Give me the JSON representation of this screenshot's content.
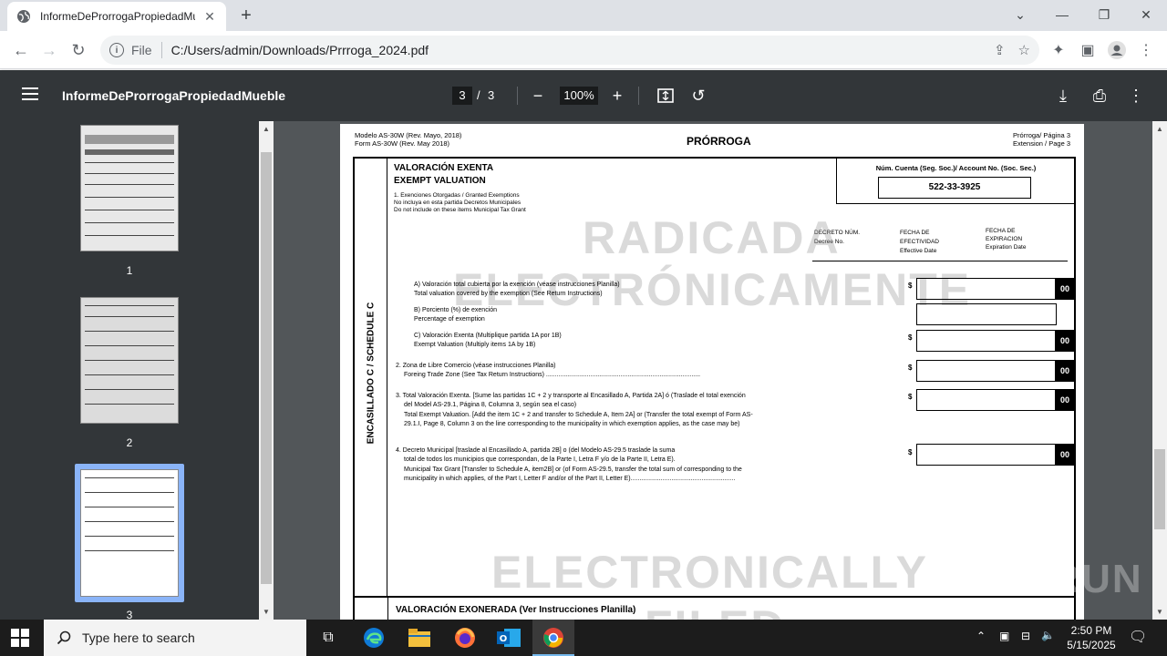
{
  "browser": {
    "tab_title": "InformeDeProrrogaPropiedadMueble",
    "url_scheme": "File",
    "url": "C:/Users/admin/Downloads/Prrroga_2024.pdf"
  },
  "pdf_toolbar": {
    "doc_title": "InformeDeProrrogaPropiedadMueble",
    "current_page": "3",
    "page_sep": "/",
    "total_pages": "3",
    "zoom": "100%"
  },
  "thumbnails": [
    {
      "label": "1"
    },
    {
      "label": "2"
    },
    {
      "label": "3"
    }
  ],
  "page": {
    "model_es": "Modelo AS-30W (Rev. Mayo, 2018)",
    "model_en": "Form AS-30W  (Rev. May 2018)",
    "title": "PRÓRROGA",
    "page_es": "Prórroga/ Página 3",
    "page_en": "Extension / Page 3",
    "account_label": "Núm. Cuenta (Seg. Soc.)/ Account No. (Soc. Sec.)",
    "account_value": "522-33-3925",
    "section_title_es": "VALORACIÓN EXENTA",
    "section_title_en": "EXEMPT VALUATION",
    "section_note_1": "1. Exenciones Otorgadas / Granted Exemptions",
    "section_note_2": "No incluya en esta partida Decretos Municipales",
    "section_note_3": "Do not include on these items Municipal Tax Grant",
    "col_decree_es": "DECRETO NÚM.",
    "col_decree_en": "Decree No.",
    "col_eff_es_1": "FECHA DE",
    "col_eff_es_2": "EFECTIVIDAD",
    "col_eff_en": "Effective Date",
    "col_exp_es_1": "FECHA DE",
    "col_exp_es_2": "EXPIRACION",
    "col_exp_en": "Expiration Date",
    "vertical_label": "ENCASILLADO C / SCHEDULE C",
    "item_a_es": "A) Valoración total cubierta por la exención (véase instrucciones Planilla)",
    "item_a_en": "Total valuation covered by the exemption (See Return Instructions)",
    "item_b_es": "B) Porciento (%) de exención",
    "item_b_en": "Percentage of exemption",
    "item_c_es": "C) Valoración Exenta (Multiplique partida 1A por 1B)",
    "item_c_en": "Exempt Valuation (Multiply items 1A by 1B)",
    "item_2_es": "2. Zona de Libre Comercio (véase instrucciones Planilla)",
    "item_2_en": "Foreing Trade Zone (See Tax Return Instructions) .......................................................................................",
    "item_3_line1": "3. Total Valoración Exenta. [Sume las partidas 1C + 2 y transporte al Encasillado A, Partida 2A] ó (Traslade el total exención",
    "item_3_line2": "del Model AS-29.1, Página 8, Columna 3, según sea el caso)",
    "item_3_line3": "Total Exempt Valuation. [Add the item 1C + 2 and transfer to Schedule A, Item 2A] or (Transfer the total exempt of Form AS-",
    "item_3_line4": "29.1.I, Page 8, Column 3 on the line corresponding to the municipality in which exemption applies, as the case may be)",
    "item_4_line1": "4. Decreto Municipal [traslade al Encasillado A, partida 2B] o (del Modelo AS-29.5 traslade la suma",
    "item_4_line2": "total de todos los municipios que correspondan, de la Parte I, Letra F y/o de la Parte II, Letra E).",
    "item_4_line3": "Municipal Tax Grant [Transfer to Schedule A, item2B] or (of Form AS-29.5, transfer the total sum of corresponding to the",
    "item_4_line4": "municipality in which applies, of the Part I, Letter F and/or of the Part II, Letter E)...........................................................",
    "currency": "$",
    "cents": "00",
    "watermark_1": "RADICADA",
    "watermark_2": "ELECTRÓNICAMENTE",
    "watermark_3": "ELECTRONICALLY",
    "watermark_4": "FILED",
    "next_section_title": "VALORACIÓN EXONERADA (Ver Instrucciones Planilla)"
  },
  "brand_watermark": "ANY RUN",
  "taskbar": {
    "search_placeholder": "Type here to search",
    "time": "2:50 PM",
    "date": "5/15/2025"
  }
}
